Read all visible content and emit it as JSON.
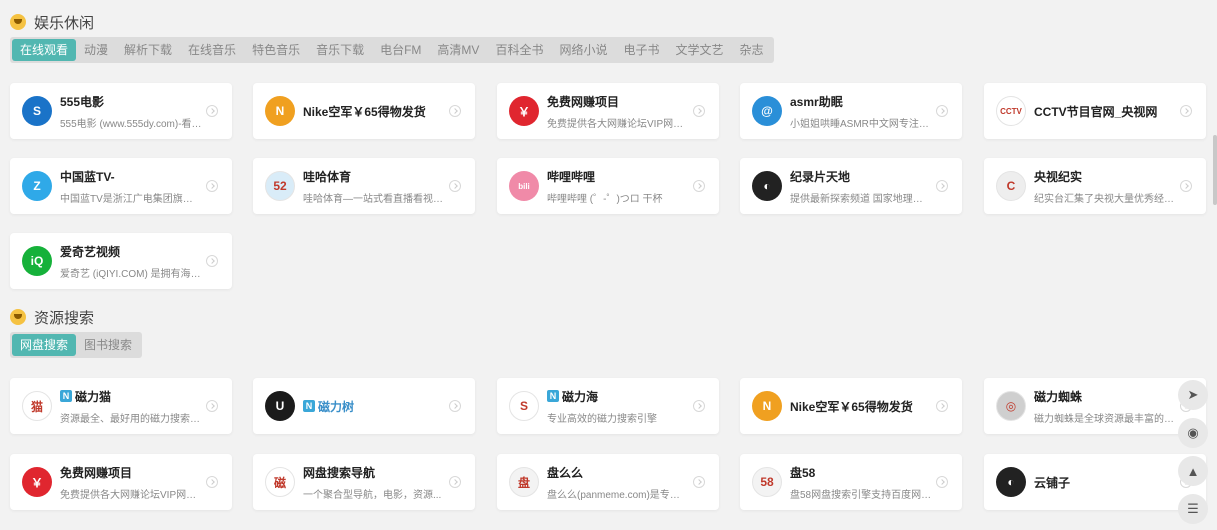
{
  "sections": [
    {
      "title": "娱乐休闲",
      "tabs": [
        "在线观看",
        "动漫",
        "解析下载",
        "在线音乐",
        "特色音乐",
        "音乐下载",
        "电台FM",
        "高清MV",
        "百科全书",
        "网络小说",
        "电子书",
        "文学文艺",
        "杂志"
      ],
      "active_tab": "在线观看",
      "cards": [
        {
          "name": "555电影",
          "desc": "555电影 (www.555dy.com)-看电影...",
          "logo_text": "S",
          "logo_color": "#1a73c8"
        },
        {
          "name": "Nike空军￥65得物发货",
          "desc": "",
          "logo_text": "N",
          "logo_color": "#f0a020"
        },
        {
          "name": "免费网赚项目",
          "desc": "免费提供各大网赚论坛VIP网赚教程...",
          "logo_text": "￥",
          "logo_color": "#e0262f"
        },
        {
          "name": "asmr助眠",
          "desc": "小姐姐哄睡ASMR中文网专注ASMR...",
          "logo_text": "@",
          "logo_color": "#2a8fd8"
        },
        {
          "name": "CCTV节目官网_央视网",
          "desc": "",
          "logo_text": "CCTV",
          "logo_color": "#ffffff"
        },
        {
          "name": "中国蓝TV-",
          "desc": "中国蓝TV是浙江广电集团旗下唯一...",
          "logo_text": "Z",
          "logo_color": "#2fa9e8"
        },
        {
          "name": "哇哈体育",
          "desc": "哇哈体育—一站式看直播看视频球...",
          "logo_text": "52",
          "logo_color": "#d9ecf8"
        },
        {
          "name": "哔哩哔哩",
          "desc": "哔哩哔哩 (゜-゜)つロ 干杯",
          "logo_text": "bili",
          "logo_color": "#f08aa8"
        },
        {
          "name": "纪录片天地",
          "desc": "提供最新探索频道 国家地理频道纪...",
          "logo_text": "◐",
          "logo_color": "#222222"
        },
        {
          "name": "央视纪实",
          "desc": "纪实台汇集了央视大量优秀经典纪...",
          "logo_text": "C",
          "logo_color": "#eeeeee"
        },
        {
          "name": "爱奇艺视频",
          "desc": "爱奇艺 (iQIYI.COM) 是拥有海量、...",
          "logo_text": "iQ",
          "logo_color": "#16b13a"
        }
      ]
    },
    {
      "title": "资源搜索",
      "tabs": [
        "网盘搜索",
        "图书搜索"
      ],
      "active_tab": "网盘搜索",
      "cards": [
        {
          "name": "磁力猫",
          "desc": "资源最全、最好用的磁力搜索引擎",
          "logo_text": "猫",
          "logo_color": "#ffffff",
          "badge": "N"
        },
        {
          "name": "磁力树",
          "desc": "",
          "logo_text": "U",
          "logo_color": "#1b1b1b",
          "badge": "N",
          "blue": true
        },
        {
          "name": "磁力海",
          "desc": "专业高效的磁力搜索引擎",
          "logo_text": "S",
          "logo_color": "#ffffff",
          "badge": "N"
        },
        {
          "name": "Nike空军￥65得物发货",
          "desc": "",
          "logo_text": "N",
          "logo_color": "#f0a020"
        },
        {
          "name": "磁力蜘蛛",
          "desc": "磁力蜘蛛是全球资源最丰富的磁力...",
          "logo_text": "◎",
          "logo_color": "#cfcfcf"
        },
        {
          "name": "免费网赚项目",
          "desc": "免费提供各大网赚论坛VIP网赚教程...",
          "logo_text": "￥",
          "logo_color": "#e0262f"
        },
        {
          "name": "网盘搜索导航",
          "desc": "一个聚合型导航，电影，资源...",
          "logo_text": "磁",
          "logo_color": "#ffffff"
        },
        {
          "name": "盘么么",
          "desc": "盘么么(panmeme.com)是专业的网...",
          "logo_text": "盘",
          "logo_color": "#f3f3f3"
        },
        {
          "name": "盘58",
          "desc": "盘58网盘搜索引擎支持百度网盘搜...",
          "logo_text": "58",
          "logo_color": "#f3f3f3"
        },
        {
          "name": "云铺子",
          "desc": "",
          "logo_text": "◐",
          "logo_color": "#222222"
        }
      ]
    }
  ]
}
